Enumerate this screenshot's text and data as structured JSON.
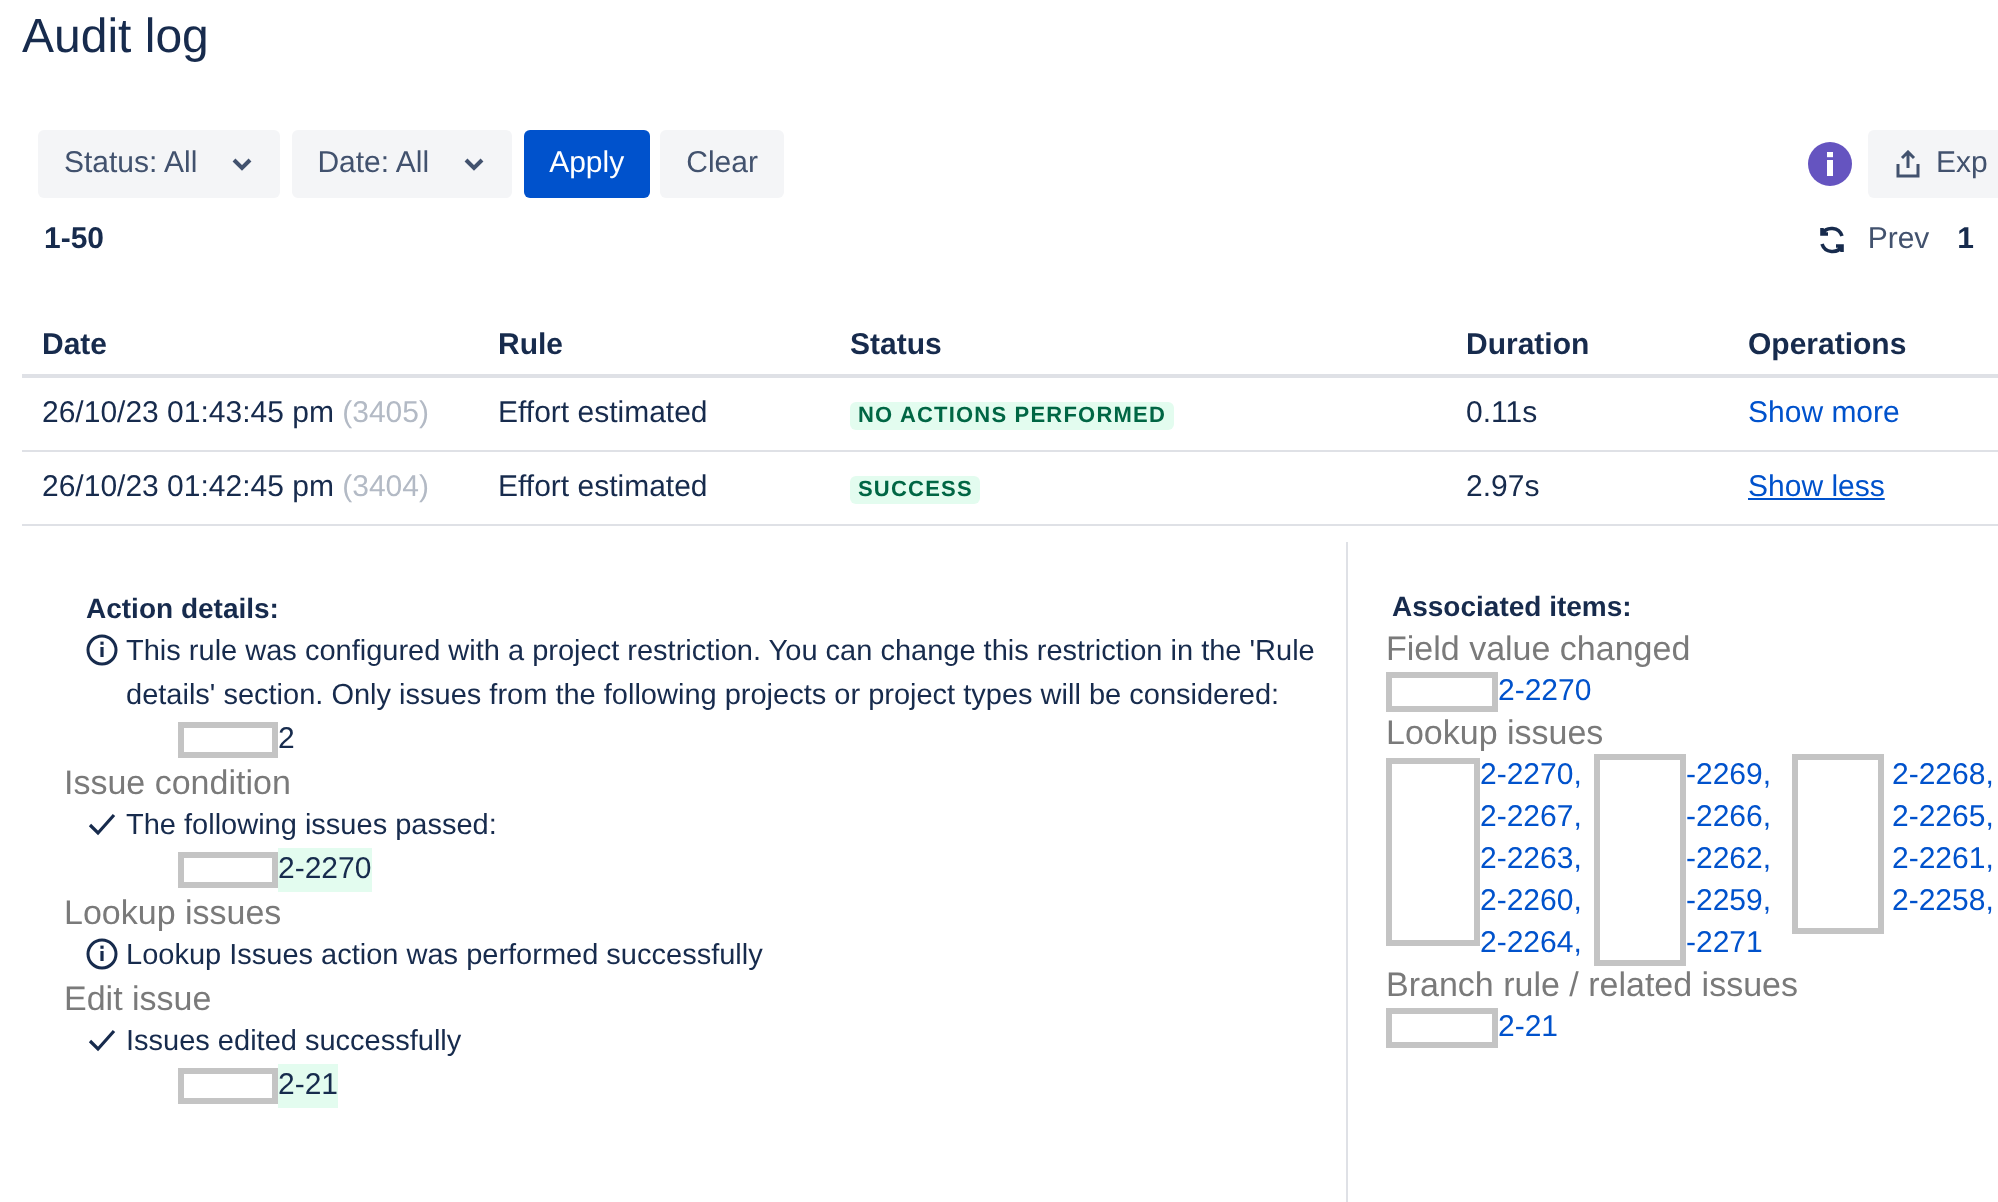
{
  "title": "Audit log",
  "filters": [
    {
      "label": "Status: All"
    },
    {
      "label": "Date: All"
    }
  ],
  "buttons": [
    {
      "label": "Apply",
      "kind": "primary"
    },
    {
      "label": "Clear",
      "kind": "subtle"
    }
  ],
  "export_button": {
    "label": "Exp"
  },
  "range": "1-50",
  "pagination": {
    "prev": "Prev",
    "page": "1"
  },
  "table": {
    "columns": [
      "Date",
      "Rule",
      "Status",
      "Duration",
      "Operations"
    ],
    "rows": [
      {
        "date": "26/10/23 01:43:45 pm",
        "id": "(3405)",
        "rule": "Effort estimated",
        "status": "NO ACTIONS PERFORMED",
        "duration": "0.11s",
        "operation": "Show more",
        "expanded": false
      },
      {
        "date": "26/10/23 01:42:45 pm",
        "id": "(3404)",
        "rule": "Effort estimated",
        "status": "SUCCESS",
        "duration": "2.97s",
        "operation": "Show less",
        "expanded": true
      }
    ]
  },
  "action_details": {
    "title": "Action details:",
    "sections": [
      {
        "kind": "info",
        "message": "This rule was configured with a project restriction. You can change this restriction in the 'Rule details' section. Only issues from the following projects or project types will be considered:",
        "item": "2",
        "highlighted": false
      },
      {
        "heading": "Issue condition",
        "kind": "check",
        "message": "The following issues passed:",
        "item": "2-2270",
        "highlighted": true
      },
      {
        "heading": "Lookup issues",
        "kind": "info",
        "message": "Lookup Issues action was performed successfully"
      },
      {
        "heading": "Edit issue",
        "kind": "check",
        "message": "Issues edited successfully",
        "item": "2-21",
        "highlighted": true
      }
    ]
  },
  "associated_items": {
    "title": "Associated items:",
    "groups": [
      {
        "heading": "Field value changed",
        "kind": "single",
        "issues": [
          "2-2270"
        ]
      },
      {
        "heading": "Lookup issues",
        "kind": "grid",
        "issues": [
          "2-2270,",
          "-2269,",
          "2-2268,",
          "2-2267,",
          "-2266,",
          "2-2265,",
          "2-2263,",
          "-2262,",
          "2-2261,",
          "2-2260,",
          "-2259,",
          "2-2258,",
          "2-2264,",
          "-2271"
        ]
      },
      {
        "heading": "Branch rule / related issues",
        "kind": "single",
        "issues": [
          "2-21"
        ]
      }
    ]
  }
}
